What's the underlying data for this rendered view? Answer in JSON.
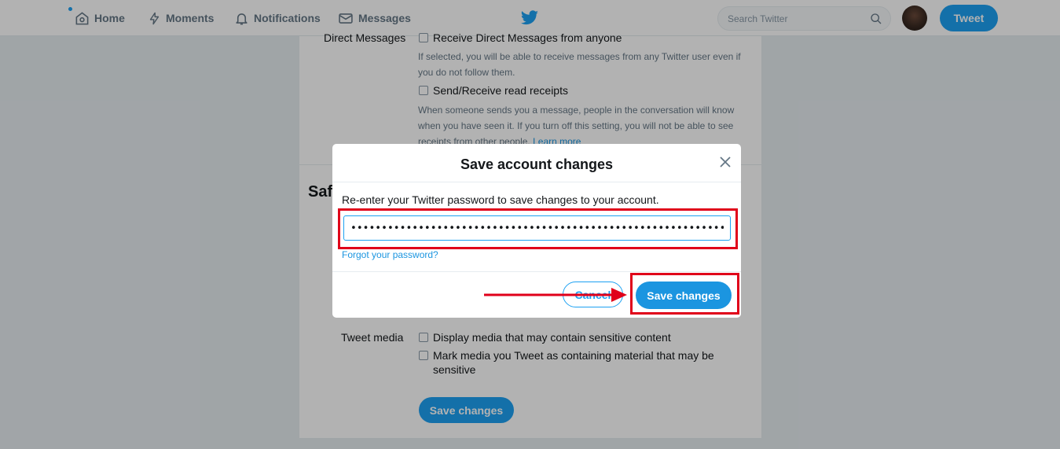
{
  "nav": {
    "home": "Home",
    "moments": "Moments",
    "notifications": "Notifications",
    "messages": "Messages",
    "search_placeholder": "Search Twitter",
    "tweet_button": "Tweet"
  },
  "settings": {
    "dm_label": "Direct Messages",
    "dm_option1": "Receive Direct Messages from anyone",
    "dm_help1": "If selected, you will be able to receive messages from any Twitter user even if you do not follow them.",
    "dm_option2": "Send/Receive read receipts",
    "dm_help2": "When someone sends you a message, people in the conversation will know when you have seen it. If you turn off this setting, you will not be able to see receipts from other people.",
    "learn_more": "Learn more",
    "safety_title": "Saf",
    "tweet_media_label": "Tweet media",
    "media_option1": "Display media that may contain sensitive content",
    "media_option2": "Mark media you Tweet as containing material that may be sensitive",
    "save_button": "Save changes"
  },
  "modal": {
    "title": "Save account changes",
    "description": "Re-enter your Twitter password to save changes to your account.",
    "password_value": "••••••••••••••••••••••••••••••••••••••••••••••••••••••••••••••••••••••••••••",
    "forgot_link": "Forgot your password?",
    "cancel_button": "Cancel",
    "save_button": "Save changes"
  },
  "colors": {
    "brand": "#1da1f2",
    "annotation": "#e0001a"
  }
}
